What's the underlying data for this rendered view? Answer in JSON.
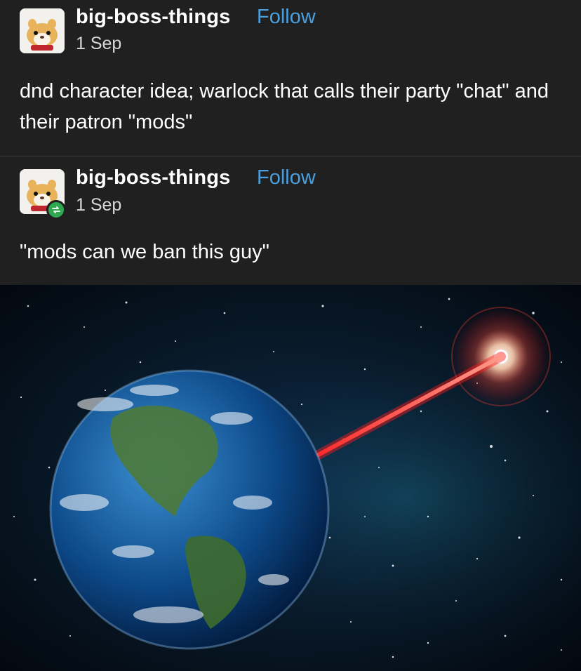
{
  "posts": [
    {
      "username": "big-boss-things",
      "follow_label": "Follow",
      "date": "1 Sep",
      "text": "dnd character idea; warlock that calls their party \"chat\" and their patron \"mods\""
    },
    {
      "username": "big-boss-things",
      "follow_label": "Follow",
      "date": "1 Sep",
      "text": "\"mods can we ban this guy\"",
      "reblog_icon": "reblog-icon"
    }
  ],
  "image": {
    "subject": "earth-laser-icon"
  },
  "colors": {
    "background": "#202020",
    "follow": "#4a9fde",
    "reblog_badge": "#2fa84f",
    "laser": "#ff2a2a"
  }
}
